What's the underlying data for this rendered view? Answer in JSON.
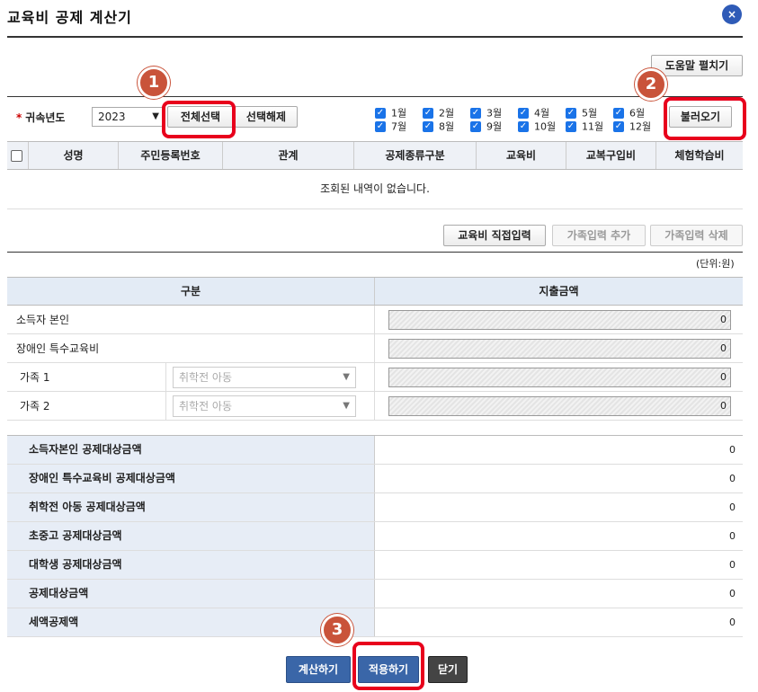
{
  "window": {
    "title": "교육비 공제 계산기",
    "close_label": "×"
  },
  "toolbar": {
    "help_label": "도움말 펼치기"
  },
  "filter": {
    "required_mark": "*",
    "year_label": "귀속년도",
    "year_value": "2023",
    "year_arrow": "▼",
    "select_all_label": "전체선택",
    "deselect_label": "선택해제",
    "load_label": "불러오기",
    "checkmark": "✓",
    "months": [
      "1월",
      "2월",
      "3월",
      "4월",
      "5월",
      "6월",
      "7월",
      "8월",
      "9월",
      "10월",
      "11월",
      "12월"
    ]
  },
  "grid": {
    "columns": [
      "성명",
      "주민등록번호",
      "관계",
      "공제종류구분",
      "교육비",
      "교복구입비",
      "체험학습비"
    ],
    "empty_message": "조회된 내역이 없습니다."
  },
  "actions": {
    "direct_input_label": "교육비 직접입력",
    "add_family_label": "가족입력 추가",
    "delete_family_label": "가족입력 삭제"
  },
  "unit_label": "(단위:원)",
  "amount_table": {
    "header_category": "구분",
    "header_amount": "지출금액",
    "rows": [
      {
        "label": "소득자 본인",
        "value": "0"
      },
      {
        "label": "장애인 특수교육비",
        "value": "0"
      },
      {
        "label": "가족 1",
        "select": "취학전 아동",
        "value": "0"
      },
      {
        "label": "가족 2",
        "select": "취학전 아동",
        "value": "0"
      }
    ]
  },
  "summary": [
    {
      "label": "소득자본인 공제대상금액",
      "value": "0"
    },
    {
      "label": "장애인 특수교육비 공제대상금액",
      "value": "0"
    },
    {
      "label": "취학전 아동 공제대상금액",
      "value": "0"
    },
    {
      "label": "초중고 공제대상금액",
      "value": "0"
    },
    {
      "label": "대학생 공제대상금액",
      "value": "0"
    },
    {
      "label": "공제대상금액",
      "value": "0"
    },
    {
      "label": "세액공제액",
      "value": "0"
    }
  ],
  "footer": {
    "calculate_label": "계산하기",
    "apply_label": "적용하기",
    "close_label": "닫기"
  },
  "annotations": {
    "badge1": "1",
    "badge2": "2",
    "badge3": "3"
  },
  "colors": {
    "highlight": "#e8001c",
    "badge": "#c9533a",
    "primary": "#3a66a8",
    "checkbox": "#1a73e8"
  }
}
